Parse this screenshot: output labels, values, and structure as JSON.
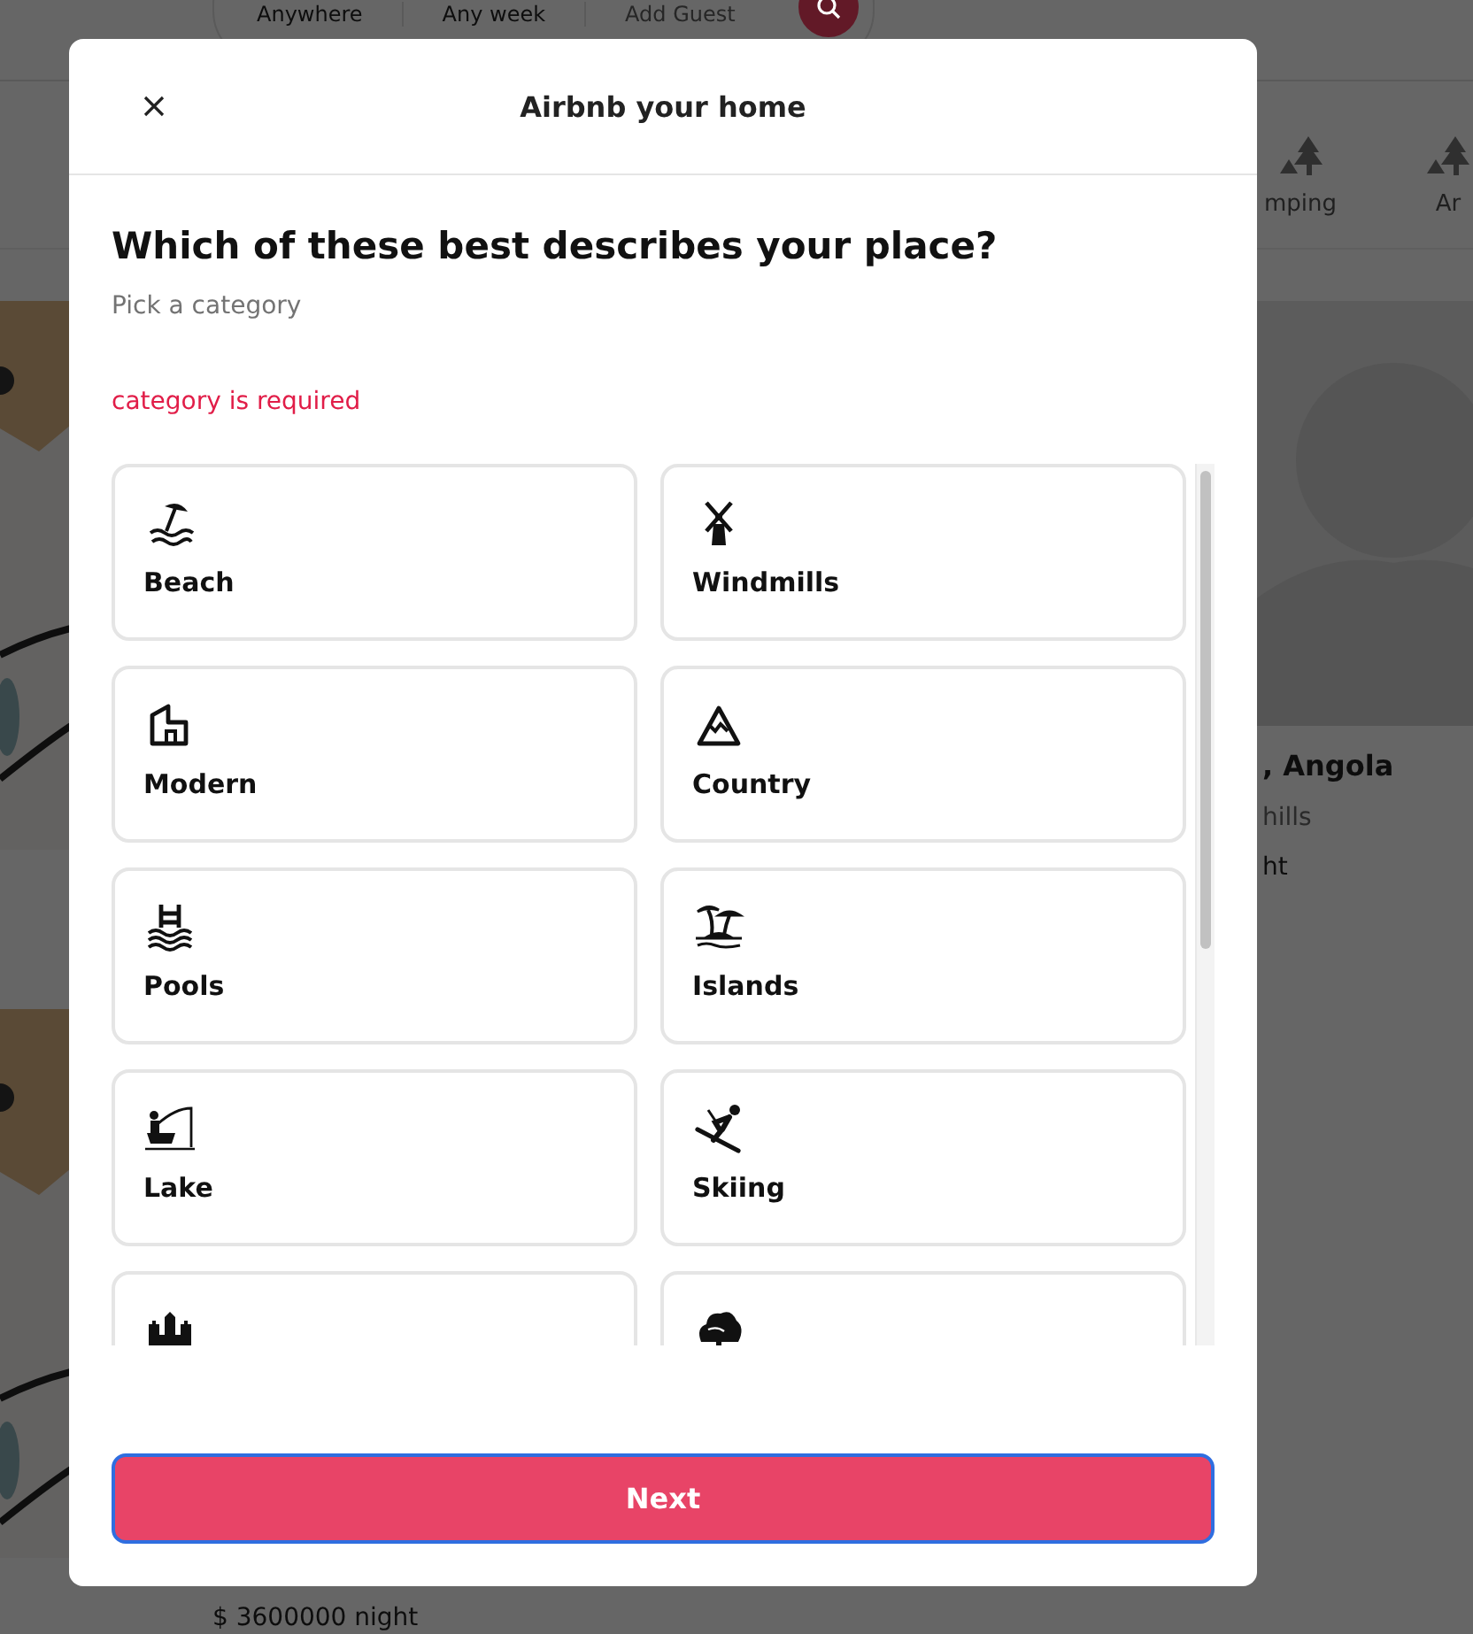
{
  "header": {
    "search": [
      {
        "label": "Anywhere",
        "kind": "item"
      },
      {
        "label": "Any week",
        "kind": "item"
      },
      {
        "label": "Add Guest",
        "kind": "hint"
      }
    ]
  },
  "categories_bar": [
    {
      "label": "mping"
    },
    {
      "label": "Ar"
    }
  ],
  "listings": {
    "right_card": {
      "title": ", Angola",
      "category": "hills",
      "price": "ht"
    },
    "bottom_price": "$ 3600000 night"
  },
  "modal": {
    "title": "Airbnb your home",
    "heading": "Which of these best describes your place?",
    "subheading": "Pick a category",
    "error": "category is required",
    "categories": [
      {
        "label": "Beach",
        "selected": false
      },
      {
        "label": "Windmills",
        "selected": false
      },
      {
        "label": "Modern",
        "selected": false
      },
      {
        "label": "Country",
        "selected": false
      },
      {
        "label": "Pools",
        "selected": false
      },
      {
        "label": "Islands",
        "selected": false
      },
      {
        "label": "Lake",
        "selected": false
      },
      {
        "label": "Skiing",
        "selected": false
      },
      {
        "selected": false
      },
      {
        "selected": false
      }
    ],
    "next_button": "Next"
  }
}
